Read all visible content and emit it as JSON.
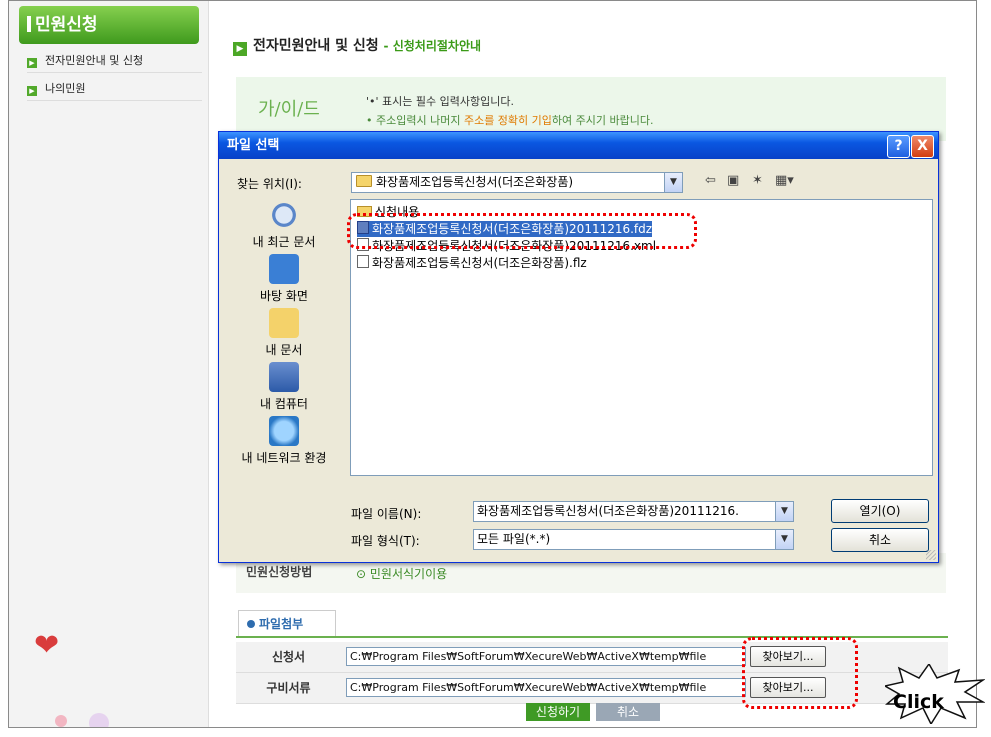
{
  "sidebar": {
    "title": "민원신청",
    "items": [
      {
        "label": "전자민원안내 및 신청"
      },
      {
        "label": "나의민원"
      }
    ]
  },
  "main": {
    "title": "전자민원안내 및 신청",
    "subtitle": "- 신청처리절차안내",
    "guide": {
      "logo": "가/이/드",
      "line1": "'•' 표시는 필수 입력사항입니다.",
      "line2_prefix": "• 주소입력시 나머지",
      "line2_highlight": "주소를 정확히 기입",
      "line2_suffix": "하여 주시기 바랍니다."
    },
    "method": {
      "label": "민원신청방법",
      "value": "⊙ 민원서식기이용"
    },
    "attach_tab": "파일첨부",
    "attach_rows": [
      {
        "label": "신청서",
        "path": "C:₩Program Files₩SoftForum₩XecureWeb₩ActiveX₩temp₩file",
        "button": "찾아보기..."
      },
      {
        "label": "구비서류",
        "path": "C:₩Program Files₩SoftForum₩XecureWeb₩ActiveX₩temp₩file",
        "button": "찾아보기..."
      }
    ],
    "submit_label": "신청하기",
    "cancel_label": "취소"
  },
  "dialog": {
    "title": "파일 선택",
    "help_btn": "?",
    "close_btn": "X",
    "lookin_label": "찾는 위치(I):",
    "lookin_value": "화장품제조업등록신청서(더조은화장품)",
    "places": [
      "내 최근 문서",
      "바탕 화면",
      "내 문서",
      "내 컴퓨터",
      "내 네트워크 환경"
    ],
    "files": [
      {
        "name": "신청내용",
        "type": "folder"
      },
      {
        "name": "화장품제조업등록신청서(더조은화장품)20111216.fdz",
        "type": "fdz",
        "selected": true
      },
      {
        "name": "화장품제조업등록신청서(더조은화장품)20111216.xml",
        "type": "xml"
      },
      {
        "name": "화장품제조업등록신청서(더조은화장품).flz",
        "type": "flz"
      }
    ],
    "filename_label": "파일 이름(N):",
    "filename_value": "화장품제조업등록신청서(더조은화장품)20111216.",
    "filetype_label": "파일 형식(T):",
    "filetype_value": "모든 파일(*.*)",
    "open_btn": "열기(O)",
    "cancel_btn": "취소"
  },
  "annotation": {
    "click_text": "Click"
  },
  "colors": {
    "accent_green": "#3f9a25",
    "dialog_blue": "#0a57e1",
    "highlight_red": "#e00000"
  }
}
